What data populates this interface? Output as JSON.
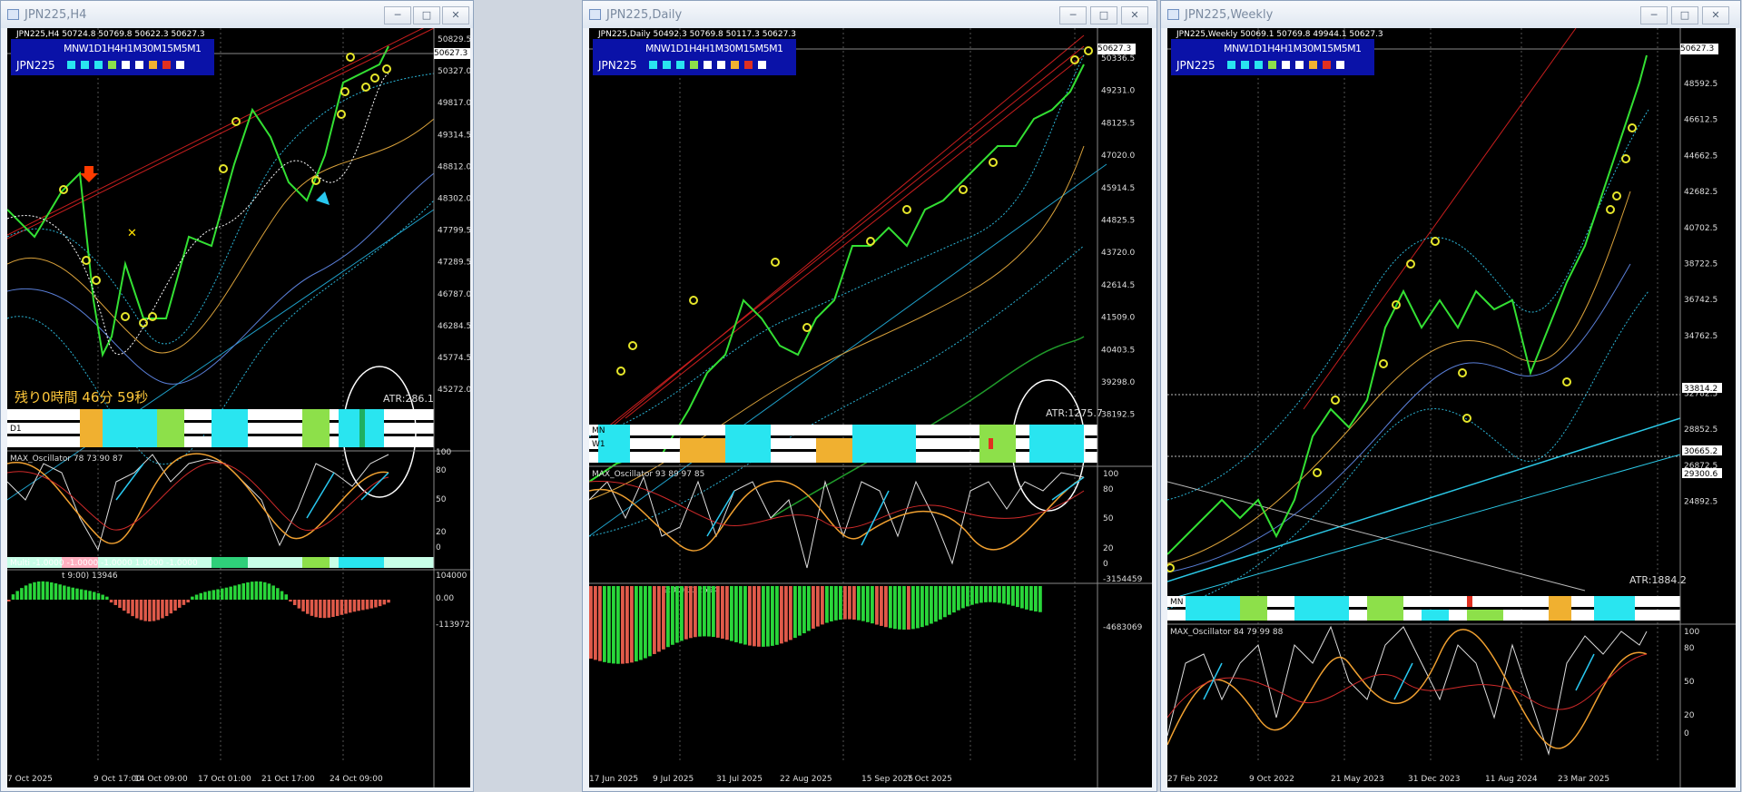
{
  "windows": [
    {
      "id": "h4",
      "title": "JPN225,H4",
      "ohlc_header": "JPN225,H4  50724.8 50769.8 50622.3 50627.3",
      "symbol_label": "JPN225",
      "tf_labels": "MNW1D1H4H1M30M15M5M1",
      "current_price": "50627.3",
      "price_ticks": [
        "50829.5",
        "50327.0",
        "49817.0",
        "49314.5",
        "48812.0",
        "48302.0",
        "47799.5",
        "47289.5",
        "46787.0",
        "46284.5",
        "45774.5",
        "45272.0"
      ],
      "date_ticks": [
        "7 Oct 2025",
        "9 Oct 17:00",
        "14 Oct 09:00",
        "17 Oct 01:00",
        "21 Oct 17:00",
        "24 Oct 09:00"
      ],
      "atr_label": "ATR:286.1",
      "countdown": "残り0時間 46分 59秒",
      "band_label": "D1",
      "osc_label": "MAX_Oscillator 78 73 90 87",
      "osc_ticks": [
        "100",
        "80",
        "50",
        "20",
        "0"
      ],
      "multi_label": "Multi -1.0000 -1.0000 -1.0000 1.0000 -1.0000",
      "hist_label": "t 9:00) 13946",
      "hist_ticks": [
        "104000",
        "0.00",
        "-113972"
      ]
    },
    {
      "id": "d1",
      "title": "JPN225,Daily",
      "ohlc_header": "JPN225,Daily  50492.3 50769.8 50117.3 50627.3",
      "symbol_label": "JPN225",
      "tf_labels": "MNW1D1H4H1M30M15M5M1",
      "current_price": "50627.3",
      "price_ticks": [
        "50336.5",
        "49231.0",
        "48125.5",
        "47020.0",
        "45914.5",
        "44825.5",
        "43720.0",
        "42614.5",
        "41509.0",
        "40403.5",
        "39298.0",
        "38192.5"
      ],
      "date_ticks": [
        "17 Jun 2025",
        "9 Jul 2025",
        "31 Jul 2025",
        "22 Aug 2025",
        "15 Sep 2025",
        "7 Oct 2025"
      ],
      "atr_label": "ATR:1275.7",
      "band_labels": [
        "MN",
        "W1"
      ],
      "osc_label": "MAX_Oscillator 93 89 97 85",
      "osc_ticks": [
        "100",
        "80",
        "50",
        "20",
        "0"
      ],
      "hist_label": "t 9:00) 322594",
      "hist_ticks": [
        "-3154459",
        "-4683069"
      ]
    },
    {
      "id": "w1",
      "title": "JPN225,Weekly",
      "ohlc_header": "JPN225,Weekly  50069.1 50769.8 49944.1 50627.3",
      "symbol_label": "JPN225",
      "tf_labels": "MNW1D1H4H1M30M15M5M1",
      "current_price": "50627.3",
      "price_ticks": [
        "48592.5",
        "46612.5",
        "44662.5",
        "42682.5",
        "40702.5",
        "38722.5",
        "36742.5",
        "34762.5",
        "32782.5",
        "28852.5",
        "26872.5",
        "24892.5"
      ],
      "level_labels": [
        "33814.2",
        "30665.2",
        "29300.6"
      ],
      "date_ticks": [
        "27 Feb 2022",
        "9 Oct 2022",
        "21 May 2023",
        "31 Dec 2023",
        "11 Aug 2024",
        "23 Mar 2025"
      ],
      "atr_label": "ATR:1884.2",
      "band_label": "MN",
      "osc_label": "MAX_Oscillator 84 79 99 88",
      "osc_ticks": [
        "100",
        "80",
        "50",
        "20",
        "0"
      ]
    }
  ],
  "chart_data": [
    {
      "type": "line",
      "title": "JPN225,H4",
      "x": [
        "7 Oct 2025",
        "9 Oct 17:00",
        "14 Oct 09:00",
        "17 Oct 01:00",
        "21 Oct 17:00",
        "24 Oct 09:00"
      ],
      "series": [
        {
          "values": [
            47900,
            46500,
            46800,
            48000,
            48300,
            50600
          ]
        }
      ],
      "ylim": [
        45000,
        51000
      ]
    },
    {
      "type": "line",
      "title": "JPN225,Daily",
      "x": [
        "17 Jun 2025",
        "9 Jul 2025",
        "31 Jul 2025",
        "22 Aug 2025",
        "15 Sep 2025",
        "7 Oct 2025"
      ],
      "series": [
        {
          "values": [
            38400,
            39800,
            41300,
            42900,
            44700,
            48000
          ]
        }
      ],
      "ylim": [
        37800,
        51000
      ]
    },
    {
      "type": "line",
      "title": "JPN225,Weekly",
      "x": [
        "27 Feb 2022",
        "9 Oct 2022",
        "21 May 2023",
        "31 Dec 2023",
        "11 Aug 2024",
        "23 Mar 2025"
      ],
      "series": [
        {
          "values": [
            26500,
            27100,
            30800,
            33300,
            36000,
            35500
          ]
        }
      ],
      "ylim": [
        23000,
        51500
      ]
    }
  ]
}
